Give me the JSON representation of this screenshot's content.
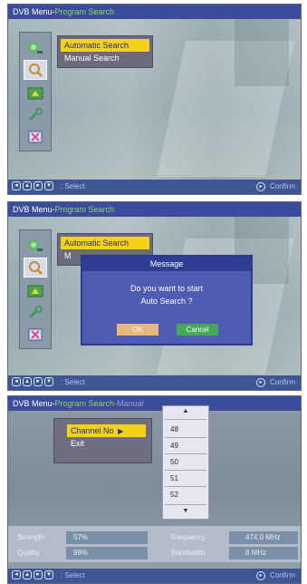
{
  "screens": [
    {
      "title": "DVB Menu",
      "separator": "-",
      "subtitle": "Program Search",
      "menu": [
        "Automatic Search",
        "Manual Search"
      ],
      "bottom": {
        "select_label": ": Select",
        "confirm_label": "Confirm"
      }
    },
    {
      "title": "DVB Menu",
      "separator": "-",
      "subtitle": "Program Search",
      "menu": [
        "Automatic Search",
        "M"
      ],
      "dialog": {
        "title": "Message",
        "line1": "Do you want to start",
        "line2": "Auto Search ?",
        "ok": "OK",
        "cancel": "Cancel"
      },
      "bottom": {
        "select_label": ": Select",
        "confirm_label": "Confirm"
      }
    },
    {
      "title": "DVB Menu",
      "separator": "-",
      "subtitle": "Program Search",
      "subtitle2": "-Manual",
      "menu": [
        "Channel No",
        "Exit"
      ],
      "channels": [
        "48",
        "49",
        "50",
        "51",
        "52"
      ],
      "stats": {
        "strength_label": "Strength",
        "strength_value": "57%",
        "quality_label": "Quality",
        "quality_value": "99%",
        "frequency_label": "Frequency",
        "frequency_value": "474.0 MHz",
        "bandwidth_label": "Bandwidth",
        "bandwidth_value": "8 MHz"
      },
      "bottom": {
        "select_label": ": Select",
        "confirm_label": "Confirm"
      }
    }
  ],
  "icons": [
    "satellite-icon",
    "search-icon",
    "antenna-icon",
    "wrench-icon",
    "delete-icon"
  ],
  "colors": {
    "title_bar": "#3b4d9a",
    "highlight": "#f4d21a",
    "subtitle_green": "#8fd26a",
    "dialog_bg": "#4e5cb4"
  }
}
